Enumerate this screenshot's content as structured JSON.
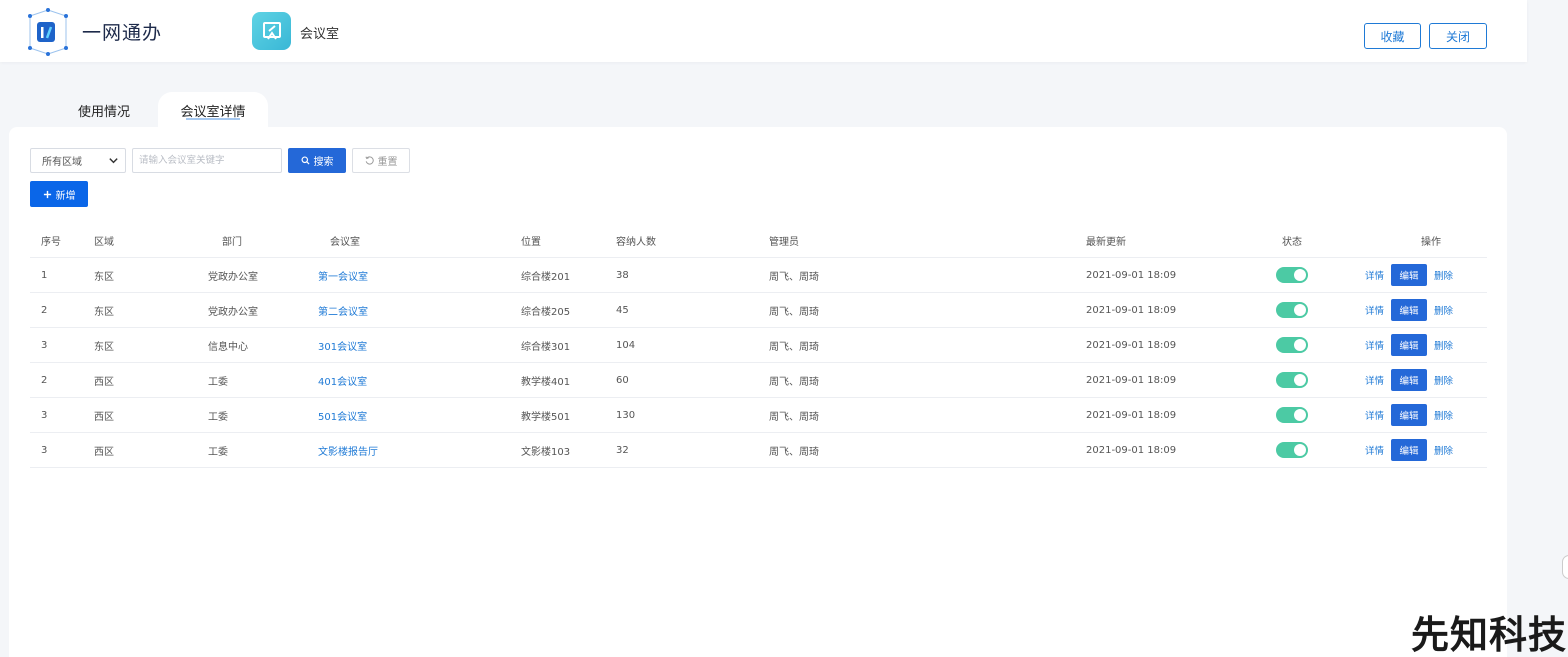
{
  "header": {
    "logo_text": "一网通办",
    "app_name": "会议室",
    "favorite_label": "收藏",
    "close_label": "关闭"
  },
  "tabs": [
    {
      "label": "使用情况"
    },
    {
      "label": "会议室详情"
    }
  ],
  "toolbar": {
    "area_select_value": "所有区域",
    "search_placeholder": "请输入会议室关键字",
    "search_label": "搜索",
    "reset_label": "重置",
    "add_label": "新增"
  },
  "table": {
    "headers": {
      "seq": "序号",
      "area": "区域",
      "dept": "部门",
      "room": "会议室",
      "location": "位置",
      "capacity": "容纳人数",
      "admin": "管理员",
      "updated": "最新更新",
      "status": "状态",
      "ops": "操作"
    },
    "ops_labels": {
      "detail": "详情",
      "edit": "编辑",
      "delete": "删除"
    },
    "rows": [
      {
        "seq": "1",
        "area": "东区",
        "dept": "党政办公室",
        "room": "第一会议室",
        "location": "综合楼201",
        "capacity": "38",
        "admin": "周飞、周琦",
        "updated": "2021-09-01  18:09",
        "enabled": true
      },
      {
        "seq": "2",
        "area": "东区",
        "dept": "党政办公室",
        "room": "第二会议室",
        "location": "综合楼205",
        "capacity": "45",
        "admin": "周飞、周琦",
        "updated": "2021-09-01  18:09",
        "enabled": true
      },
      {
        "seq": "3",
        "area": "东区",
        "dept": "信息中心",
        "room": "301会议室",
        "location": "综合楼301",
        "capacity": "104",
        "admin": "周飞、周琦",
        "updated": "2021-09-01  18:09",
        "enabled": true
      },
      {
        "seq": "2",
        "area": "西区",
        "dept": "工委",
        "room": "401会议室",
        "location": "教学楼401",
        "capacity": "60",
        "admin": "周飞、周琦",
        "updated": "2021-09-01  18:09",
        "enabled": true
      },
      {
        "seq": "3",
        "area": "西区",
        "dept": "工委",
        "room": "501会议室",
        "location": "教学楼501",
        "capacity": "130",
        "admin": "周飞、周琦",
        "updated": "2021-09-01  18:09",
        "enabled": true
      },
      {
        "seq": "3",
        "area": "西区",
        "dept": "工委",
        "room": "文影楼报告厅",
        "location": "文影楼103",
        "capacity": "32",
        "admin": "周飞、周琦",
        "updated": "2021-09-01  18:09",
        "enabled": true
      }
    ]
  },
  "watermark": "先知科技",
  "colors": {
    "primary": "#2468d8",
    "link": "#1f7ad6",
    "toggle_on": "#4ccaa4"
  }
}
